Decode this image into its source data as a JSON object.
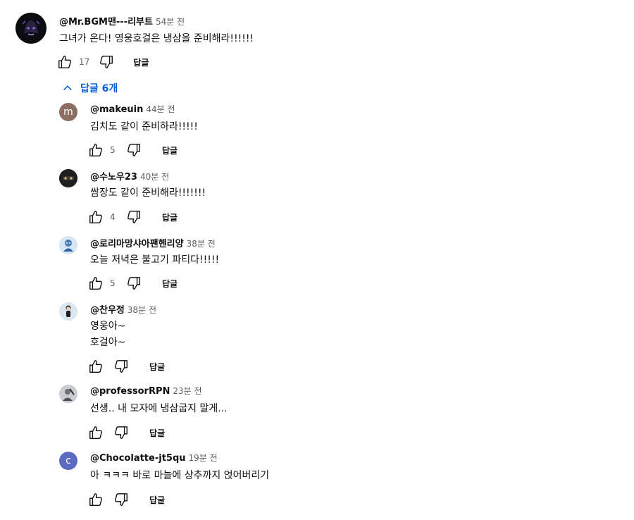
{
  "comments": [
    {
      "author": "@Mr.BGM맨---리부트",
      "time": "54분 전",
      "lines": [
        "그녀가 온다! 영웅호걸은 냉삼을 준비해라!!!!!!"
      ],
      "likes": "17",
      "reply_label": "답글",
      "avatar": {
        "type": "dark-character",
        "bg": "#0b0b12"
      }
    },
    {
      "author": "@makeuin",
      "time": "44분 전",
      "lines": [
        "김치도 같이 준비하라!!!!!"
      ],
      "likes": "5",
      "reply_label": "답글",
      "avatar": {
        "type": "letter",
        "letter": "m",
        "bg": "#8d6e63"
      }
    },
    {
      "author": "@수노우23",
      "time": "40분 전",
      "lines": [
        "쌈장도 같이 준비해라!!!!!!!"
      ],
      "likes": "4",
      "reply_label": "답글",
      "avatar": {
        "type": "dark-photo",
        "bg": "#1f1f1f"
      }
    },
    {
      "author": "@로리마망샤아팬헨리양",
      "time": "38분 전",
      "lines": [
        "오늘 저녁은 불고기 파티다!!!!!"
      ],
      "likes": "5",
      "reply_label": "답글",
      "avatar": {
        "type": "blue-figure",
        "bg": "#d7e6f3"
      }
    },
    {
      "author": "@찬우정",
      "time": "38분 전",
      "lines": [
        "영웅아~",
        "호걸아~"
      ],
      "likes": "",
      "reply_label": "답글",
      "avatar": {
        "type": "person",
        "bg": "#dbe6f2"
      }
    },
    {
      "author": "@professorRPN",
      "time": "23분 전",
      "lines": [
        "선생.. 내 모자에 냉삼굽지 말게..."
      ],
      "likes": "",
      "reply_label": "답글",
      "avatar": {
        "type": "gray-photo",
        "bg": "#c9ccd1"
      }
    },
    {
      "author": "@Chocolatte-jt5qu",
      "time": "19분 전",
      "lines": [
        "아 ㅋㅋㅋ 바로 마늘에 상추까지 얹어버리기"
      ],
      "likes": "",
      "reply_label": "답글",
      "avatar": {
        "type": "letter",
        "letter": "c",
        "bg": "#5c6bc0"
      }
    }
  ],
  "replies_toggle": {
    "label": "답글 6개",
    "color": "#065fd4"
  }
}
